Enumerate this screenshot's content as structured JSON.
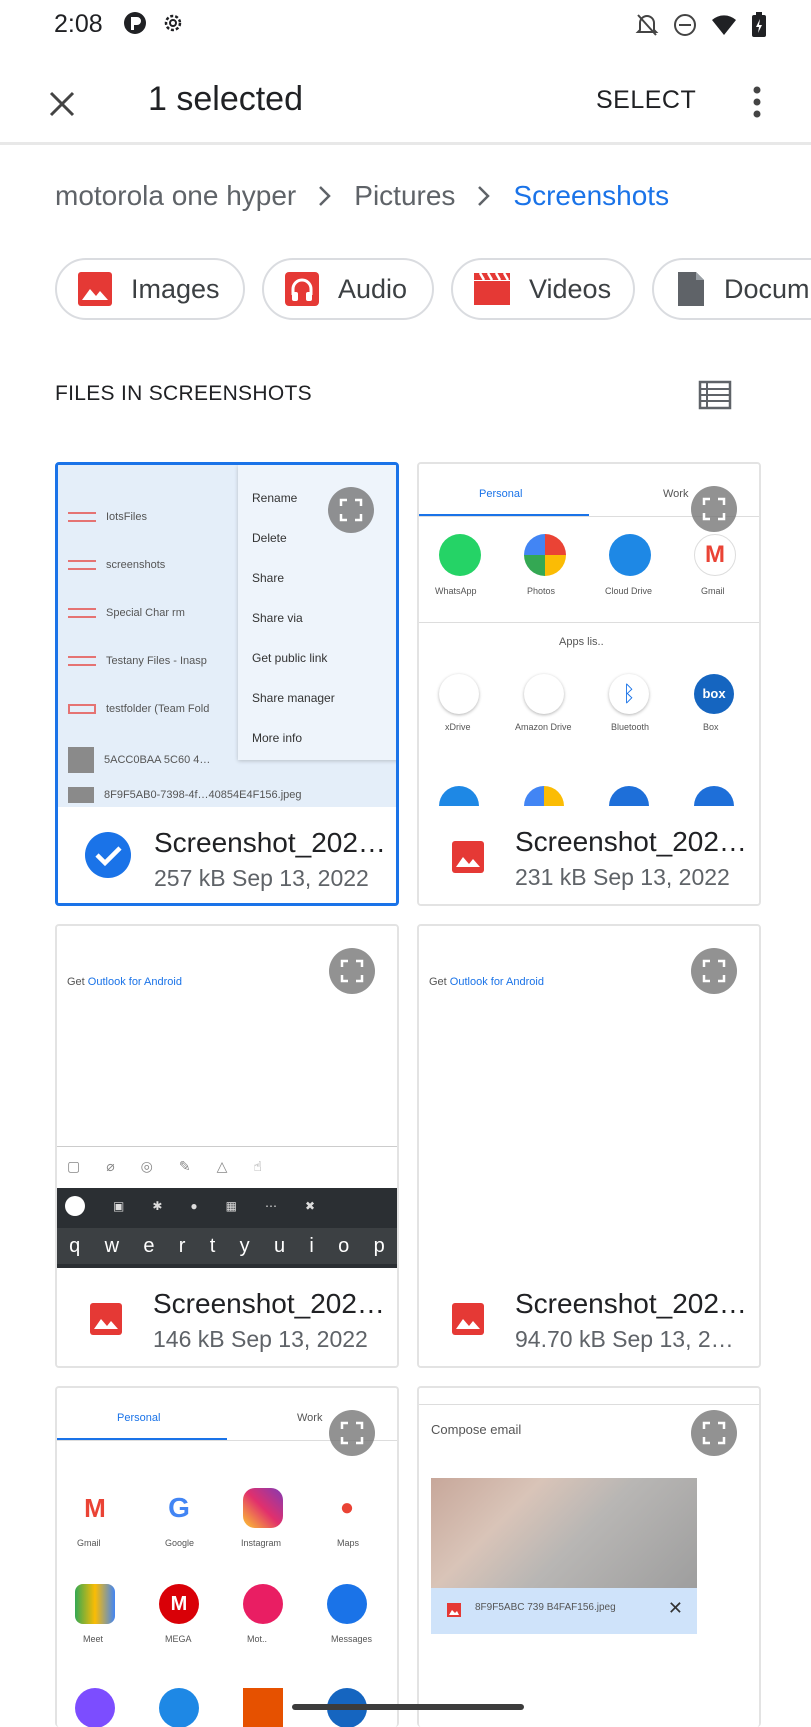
{
  "status_bar": {
    "time": "2:08"
  },
  "app_bar": {
    "title": "1 selected",
    "select_label": "SELECT"
  },
  "breadcrumb": {
    "items": [
      "motorola one hyper",
      "Pictures",
      "Screenshots"
    ]
  },
  "chips": [
    {
      "label": "Images",
      "icon": "image-icon",
      "color": "#e53935"
    },
    {
      "label": "Audio",
      "icon": "headphones-icon",
      "color": "#e53935"
    },
    {
      "label": "Videos",
      "icon": "clapperboard-icon",
      "color": "#e53935"
    },
    {
      "label": "Docum",
      "icon": "document-icon",
      "color": "#5f6368"
    }
  ],
  "section": {
    "title": "FILES IN SCREENSHOTS"
  },
  "files": [
    {
      "name": "Screenshot_202…",
      "meta": "257 kB Sep 13, 2022",
      "selected": true
    },
    {
      "name": "Screenshot_202…",
      "meta": "231 kB Sep 13, 2022",
      "selected": false
    },
    {
      "name": "Screenshot_202…",
      "meta": "146 kB Sep 13, 2022",
      "selected": false
    },
    {
      "name": "Screenshot_202…",
      "meta": "94.70 kB Sep 13, 2…",
      "selected": false
    }
  ],
  "thumb1": {
    "rows": [
      "IotsFiles",
      "screenshots",
      "Special Char rm",
      "Testany Files - Inasp",
      "testfolder (Team Fold",
      "5ACC0BAA 5C60 4…",
      "8F9F5AB0-7398-4f…40854E4F156.jpeg"
    ],
    "menu": [
      "Rename",
      "Delete",
      "Share",
      "Share via",
      "Get public link",
      "Share manager",
      "More info"
    ]
  },
  "thumb2": {
    "tabs": [
      "Personal",
      "Work"
    ],
    "apps_top": [
      "WhatsApp",
      "Photos",
      "Cloud Drive",
      "Gmail"
    ],
    "apps_title": "Apps lis..",
    "apps_mid": [
      "xDrive",
      "Amazon Drive",
      "Bluetooth",
      "Box"
    ]
  },
  "thumb3": {
    "outlook_prefix": "Get ",
    "outlook_link": "Outlook for Android",
    "keys": [
      "q",
      "w",
      "e",
      "r",
      "t",
      "y",
      "u",
      "i",
      "o",
      "p"
    ]
  },
  "thumb4": {
    "outlook_prefix": "Get ",
    "outlook_link": "Outlook for Android"
  },
  "thumb5": {
    "tabs": [
      "Personal",
      "Work"
    ],
    "apps": [
      "Gmail",
      "Google",
      "Instagram",
      "Maps",
      "Meet",
      "MEGA",
      "Mot..",
      "Messages"
    ]
  },
  "thumb6": {
    "title": "Compose email",
    "attachment": "8F9F5ABC 739 B4FAF156.jpeg"
  }
}
